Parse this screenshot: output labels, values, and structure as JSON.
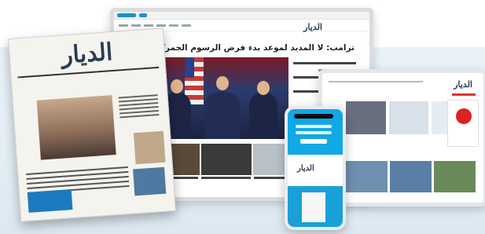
{
  "brand": {
    "name": "الديار"
  },
  "laptop": {
    "headline": "ترامب: لا المديد لموعد بدء فرض الرسوم الجمركية"
  },
  "colors": {
    "accent_blue": "#11a8e6",
    "background_band": "#e3eef5",
    "hero_dark": "#1c2442"
  }
}
